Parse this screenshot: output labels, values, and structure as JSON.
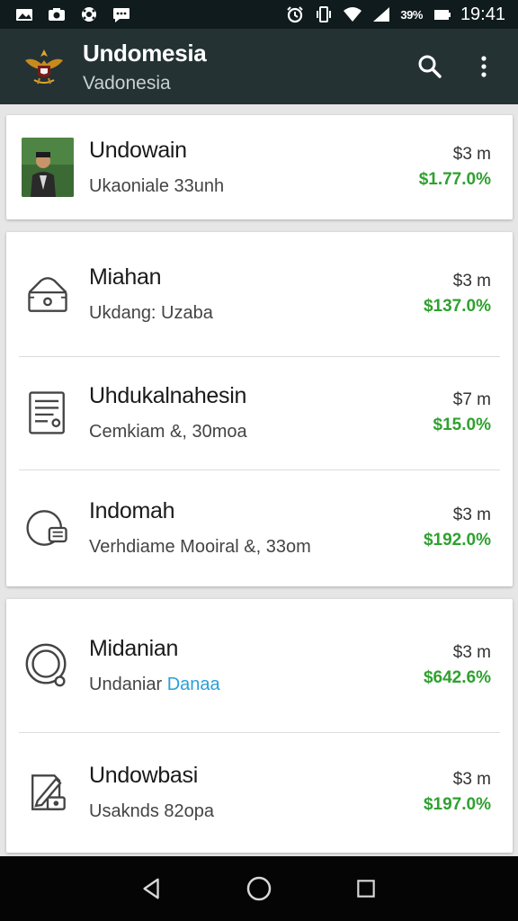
{
  "status_bar": {
    "battery_text": "39%",
    "time": "19:41"
  },
  "app_bar": {
    "title": "Undomesia",
    "subtitle": "Vadonesia"
  },
  "cards": [
    {
      "items": [
        {
          "icon": "profile-photo",
          "title": "Undowain",
          "subtitle": "Ukaoniale 33unh",
          "price": "$3 m",
          "change": "$1.77.0%"
        }
      ]
    },
    {
      "items": [
        {
          "icon": "wallet-icon",
          "title": "Miahan",
          "subtitle": "Ukdang: Uzaba",
          "price": "$3 m",
          "change": "$137.0%"
        },
        {
          "icon": "document-icon",
          "title": "Uhdukalnahesin",
          "subtitle": "Cemkiam &, 30moa",
          "price": "$7 m",
          "change": "$15.0%"
        },
        {
          "icon": "coin-icon",
          "title": "Indomah",
          "subtitle": "Verhdiame Mooiral &, 33om",
          "price": "$3 m",
          "change": "$192.0%"
        }
      ]
    },
    {
      "items": [
        {
          "icon": "ring-icon",
          "title": "Midanian",
          "subtitle": "Undaniar",
          "subtitle_highlight": "Danaa",
          "price": "$3 m",
          "change": "$642.6%"
        },
        {
          "icon": "edit-icon",
          "title": "Undowbasi",
          "subtitle": "Usaknds 82opa",
          "price": "$3 m",
          "change": "$197.0%"
        }
      ]
    }
  ],
  "colors": {
    "app_bar": "#243234",
    "status_bar": "#0f1b1c",
    "positive": "#2fa12f",
    "highlight": "#2b9fd6"
  }
}
